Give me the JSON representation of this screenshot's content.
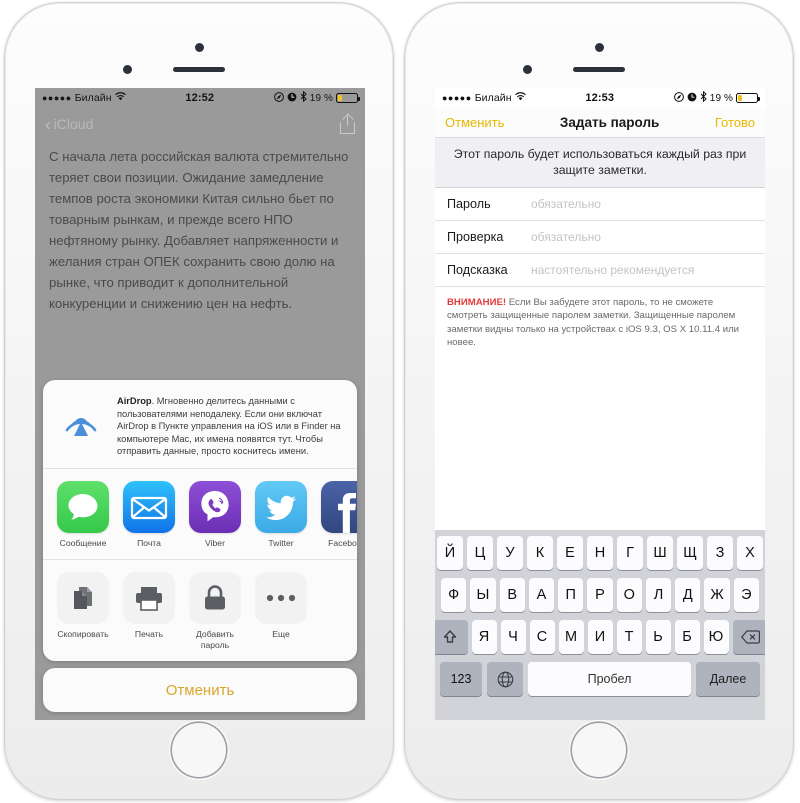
{
  "left_phone": {
    "status_bar": {
      "signal_dots": "●●●●●",
      "carrier": "Билайн",
      "wifi_icon": "wifi-icon",
      "time": "12:52",
      "location_icon": "location-icon",
      "alarm_icon": "alarm-icon",
      "bluetooth_icon": "bluetooth-icon",
      "battery_percent": "19 %"
    },
    "navbar": {
      "back_label": "iCloud",
      "back_icon": "chevron-left-icon",
      "share_icon": "share-icon"
    },
    "note_text": "С начала лета российская валюта стремительно теряет свои позиции. Ожидание замедление темпов роста экономики Китая сильно бьет по товарным рынкам, и прежде всего НПО нефтяному рынку. Добавляет напряженности и желания стран ОПЕК сохранить свою долю на рынке, что приводит к дополнительной конкуренции и снижению цен на нефть.",
    "share_sheet": {
      "airdrop": {
        "icon": "airdrop-icon",
        "title": "AirDrop",
        "description": ". Мгновенно делитесь данными с пользователями неподалеку. Если они включат AirDrop в Пункте управления на iOS или в Finder на компьютере Mac, их имена появятся тут. Чтобы отправить данные, просто коснитесь имени."
      },
      "apps": [
        {
          "name": "Сообщение",
          "icon": "messages-icon"
        },
        {
          "name": "Почта",
          "icon": "mail-icon"
        },
        {
          "name": "Viber",
          "icon": "viber-icon"
        },
        {
          "name": "Twitter",
          "icon": "twitter-icon"
        },
        {
          "name": "Facebook",
          "icon": "facebook-icon"
        },
        {
          "name": "",
          "icon": "instagram-icon"
        }
      ],
      "actions": [
        {
          "name": "Скопировать",
          "icon": "copy-icon"
        },
        {
          "name": "Печать",
          "icon": "printer-icon"
        },
        {
          "name": "Добавить пароль",
          "icon": "lock-icon"
        },
        {
          "name": "Еще",
          "icon": "more-dots-icon"
        }
      ],
      "cancel_label": "Отменить"
    }
  },
  "right_phone": {
    "status_bar": {
      "signal_dots": "●●●●●",
      "carrier": "Билайн",
      "wifi_icon": "wifi-icon",
      "time": "12:53",
      "location_icon": "location-icon",
      "alarm_icon": "alarm-icon",
      "bluetooth_icon": "bluetooth-icon",
      "battery_percent": "19 %"
    },
    "navbar": {
      "cancel_label": "Отменить",
      "title": "Задать пароль",
      "done_label": "Готово"
    },
    "header_text": "Этот пароль будет использоваться каждый раз при защите заметки.",
    "fields": [
      {
        "label": "Пароль",
        "value": "",
        "placeholder": "обязательно"
      },
      {
        "label": "Проверка",
        "value": "",
        "placeholder": "обязательно"
      },
      {
        "label": "Подсказка",
        "value": "",
        "placeholder": "настоятельно рекомендуется"
      }
    ],
    "warning": {
      "prefix": "ВНИМАНИЕ!",
      "text": " Если Вы забудете этот пароль, то не сможете смотреть защищенные паролем заметки. Защищенные паролем заметки видны только на устройствах с iOS 9.3, OS X 10.11.4 или новее."
    },
    "keyboard": {
      "row1": [
        "Й",
        "Ц",
        "У",
        "К",
        "Е",
        "Н",
        "Г",
        "Ш",
        "Щ",
        "З",
        "Х"
      ],
      "row2": [
        "Ф",
        "Ы",
        "В",
        "А",
        "П",
        "Р",
        "О",
        "Л",
        "Д",
        "Ж",
        "Э"
      ],
      "row3": [
        "Я",
        "Ч",
        "С",
        "М",
        "И",
        "Т",
        "Ь",
        "Б",
        "Ю"
      ],
      "shift_icon": "shift-icon",
      "backspace_icon": "backspace-icon",
      "numbers_label": "123",
      "globe_icon": "globe-icon",
      "space_label": "Пробел",
      "next_label": "Далее"
    }
  },
  "colors": {
    "accent_yellow": "#e6b800",
    "warning_red": "#e23b3b",
    "note_bg": "#9a9a9a",
    "keyboard_bg": "#d1d3d9"
  }
}
